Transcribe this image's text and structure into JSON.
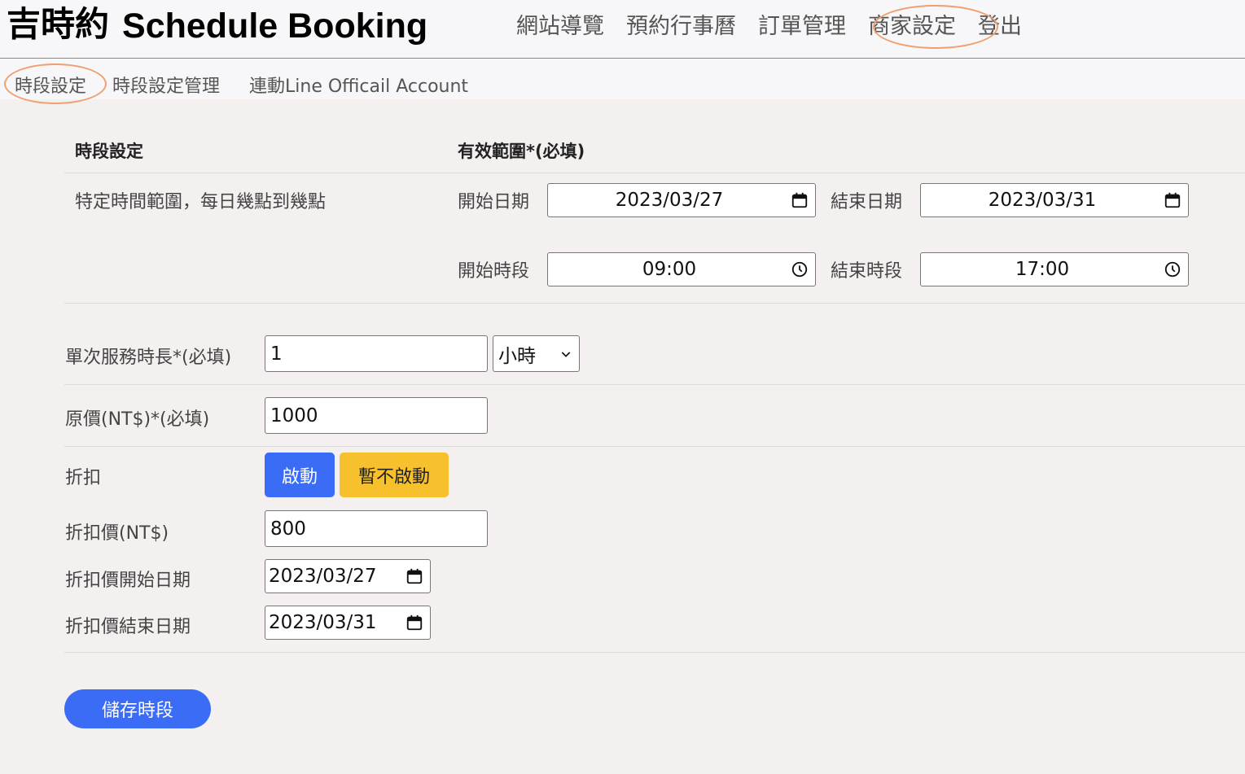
{
  "header": {
    "brand_cn": "吉時約",
    "brand_en": "Schedule Booking",
    "nav": [
      "網站導覽",
      "預約行事曆",
      "訂單管理",
      "商家設定",
      "登出"
    ]
  },
  "subnav": [
    "時段設定",
    "時段設定管理",
    "連動Line Officail Account"
  ],
  "table": {
    "col1_header": "時段設定",
    "col2_header": "有效範圍*(必填)",
    "row_label": "特定時間範圍，每日幾點到幾點",
    "start_date_label": "開始日期",
    "start_date": "2023/03/27",
    "end_date_label": "結束日期",
    "end_date": "2023/03/31",
    "start_time_label": "開始時段",
    "start_time": "09:00",
    "end_time_label": "結束時段",
    "end_time": "17:00"
  },
  "form": {
    "duration_label": "單次服務時長*(必填)",
    "duration_value": "1",
    "duration_unit": "小時",
    "price_label": "原價(NT$)*(必填)",
    "price_value": "1000",
    "discount_label": "折扣",
    "discount_on": "啟動",
    "discount_off": "暫不啟動",
    "discount_price_label": "折扣價(NT$)",
    "discount_price_value": "800",
    "discount_start_label": "折扣價開始日期",
    "discount_start_value": "2023/03/27",
    "discount_end_label": "折扣價結束日期",
    "discount_end_value": "2023/03/31"
  },
  "save_label": "儲存時段",
  "colors": {
    "primary": "#3b6cf6",
    "warning": "#f7c12d",
    "highlight_ring": "#f0a070"
  }
}
